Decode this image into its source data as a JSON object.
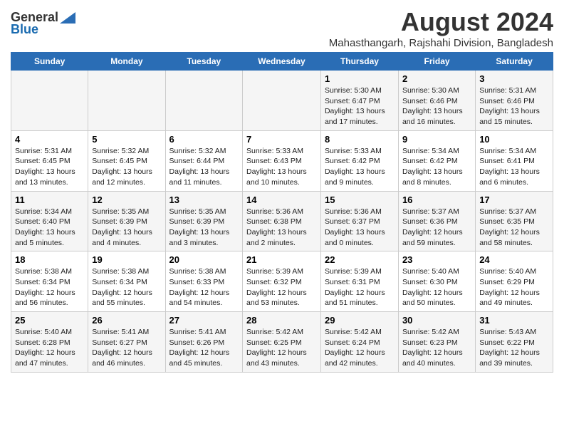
{
  "logo": {
    "general": "General",
    "blue": "Blue"
  },
  "title": "August 2024",
  "subtitle": "Mahasthangarh, Rajshahi Division, Bangladesh",
  "weekdays": [
    "Sunday",
    "Monday",
    "Tuesday",
    "Wednesday",
    "Thursday",
    "Friday",
    "Saturday"
  ],
  "weeks": [
    [
      {
        "num": "",
        "info": ""
      },
      {
        "num": "",
        "info": ""
      },
      {
        "num": "",
        "info": ""
      },
      {
        "num": "",
        "info": ""
      },
      {
        "num": "1",
        "info": "Sunrise: 5:30 AM\nSunset: 6:47 PM\nDaylight: 13 hours and 17 minutes."
      },
      {
        "num": "2",
        "info": "Sunrise: 5:30 AM\nSunset: 6:46 PM\nDaylight: 13 hours and 16 minutes."
      },
      {
        "num": "3",
        "info": "Sunrise: 5:31 AM\nSunset: 6:46 PM\nDaylight: 13 hours and 15 minutes."
      }
    ],
    [
      {
        "num": "4",
        "info": "Sunrise: 5:31 AM\nSunset: 6:45 PM\nDaylight: 13 hours and 13 minutes."
      },
      {
        "num": "5",
        "info": "Sunrise: 5:32 AM\nSunset: 6:45 PM\nDaylight: 13 hours and 12 minutes."
      },
      {
        "num": "6",
        "info": "Sunrise: 5:32 AM\nSunset: 6:44 PM\nDaylight: 13 hours and 11 minutes."
      },
      {
        "num": "7",
        "info": "Sunrise: 5:33 AM\nSunset: 6:43 PM\nDaylight: 13 hours and 10 minutes."
      },
      {
        "num": "8",
        "info": "Sunrise: 5:33 AM\nSunset: 6:42 PM\nDaylight: 13 hours and 9 minutes."
      },
      {
        "num": "9",
        "info": "Sunrise: 5:34 AM\nSunset: 6:42 PM\nDaylight: 13 hours and 8 minutes."
      },
      {
        "num": "10",
        "info": "Sunrise: 5:34 AM\nSunset: 6:41 PM\nDaylight: 13 hours and 6 minutes."
      }
    ],
    [
      {
        "num": "11",
        "info": "Sunrise: 5:34 AM\nSunset: 6:40 PM\nDaylight: 13 hours and 5 minutes."
      },
      {
        "num": "12",
        "info": "Sunrise: 5:35 AM\nSunset: 6:39 PM\nDaylight: 13 hours and 4 minutes."
      },
      {
        "num": "13",
        "info": "Sunrise: 5:35 AM\nSunset: 6:39 PM\nDaylight: 13 hours and 3 minutes."
      },
      {
        "num": "14",
        "info": "Sunrise: 5:36 AM\nSunset: 6:38 PM\nDaylight: 13 hours and 2 minutes."
      },
      {
        "num": "15",
        "info": "Sunrise: 5:36 AM\nSunset: 6:37 PM\nDaylight: 13 hours and 0 minutes."
      },
      {
        "num": "16",
        "info": "Sunrise: 5:37 AM\nSunset: 6:36 PM\nDaylight: 12 hours and 59 minutes."
      },
      {
        "num": "17",
        "info": "Sunrise: 5:37 AM\nSunset: 6:35 PM\nDaylight: 12 hours and 58 minutes."
      }
    ],
    [
      {
        "num": "18",
        "info": "Sunrise: 5:38 AM\nSunset: 6:34 PM\nDaylight: 12 hours and 56 minutes."
      },
      {
        "num": "19",
        "info": "Sunrise: 5:38 AM\nSunset: 6:34 PM\nDaylight: 12 hours and 55 minutes."
      },
      {
        "num": "20",
        "info": "Sunrise: 5:38 AM\nSunset: 6:33 PM\nDaylight: 12 hours and 54 minutes."
      },
      {
        "num": "21",
        "info": "Sunrise: 5:39 AM\nSunset: 6:32 PM\nDaylight: 12 hours and 53 minutes."
      },
      {
        "num": "22",
        "info": "Sunrise: 5:39 AM\nSunset: 6:31 PM\nDaylight: 12 hours and 51 minutes."
      },
      {
        "num": "23",
        "info": "Sunrise: 5:40 AM\nSunset: 6:30 PM\nDaylight: 12 hours and 50 minutes."
      },
      {
        "num": "24",
        "info": "Sunrise: 5:40 AM\nSunset: 6:29 PM\nDaylight: 12 hours and 49 minutes."
      }
    ],
    [
      {
        "num": "25",
        "info": "Sunrise: 5:40 AM\nSunset: 6:28 PM\nDaylight: 12 hours and 47 minutes."
      },
      {
        "num": "26",
        "info": "Sunrise: 5:41 AM\nSunset: 6:27 PM\nDaylight: 12 hours and 46 minutes."
      },
      {
        "num": "27",
        "info": "Sunrise: 5:41 AM\nSunset: 6:26 PM\nDaylight: 12 hours and 45 minutes."
      },
      {
        "num": "28",
        "info": "Sunrise: 5:42 AM\nSunset: 6:25 PM\nDaylight: 12 hours and 43 minutes."
      },
      {
        "num": "29",
        "info": "Sunrise: 5:42 AM\nSunset: 6:24 PM\nDaylight: 12 hours and 42 minutes."
      },
      {
        "num": "30",
        "info": "Sunrise: 5:42 AM\nSunset: 6:23 PM\nDaylight: 12 hours and 40 minutes."
      },
      {
        "num": "31",
        "info": "Sunrise: 5:43 AM\nSunset: 6:22 PM\nDaylight: 12 hours and 39 minutes."
      }
    ]
  ]
}
